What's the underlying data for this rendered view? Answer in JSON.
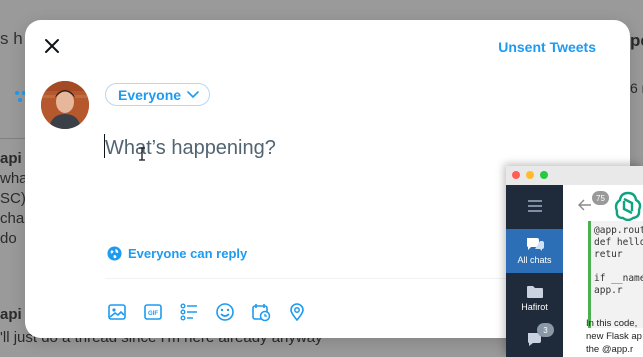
{
  "background": {
    "top_fragment": "s h",
    "right_top_fragment": "pe",
    "right_fragment": "6 m",
    "left_bold_fragment": "api",
    "left_lines": [
      "wha",
      "SC)",
      "cha",
      "do"
    ],
    "bottom_bold_fragment": "api",
    "bottom_text": "'ll just do a thread since I'm here already anyway"
  },
  "modal": {
    "unsent_label": "Unsent Tweets",
    "audience_label": "Everyone",
    "compose_placeholder": "What’s happening?",
    "reply_label": "Everyone can reply",
    "toolbar": [
      {
        "icon": "image-icon",
        "label": "Media"
      },
      {
        "icon": "gif-icon",
        "label": "GIF"
      },
      {
        "icon": "poll-icon",
        "label": "Poll"
      },
      {
        "icon": "emoji-icon",
        "label": "Emoji"
      },
      {
        "icon": "schedule-icon",
        "label": "Schedule"
      },
      {
        "icon": "location-icon",
        "label": "Location"
      }
    ]
  },
  "app": {
    "sidebar": [
      {
        "label": "All chats",
        "icon": "chat-bubbles-icon",
        "active": true
      },
      {
        "label": "Hafirot",
        "icon": "folder-icon",
        "active": false
      },
      {
        "label": "",
        "icon": "chat-icon",
        "badge": "3",
        "active": false
      }
    ],
    "header_badge": "75",
    "code_lines": [
      "@app.rout",
      "def hello",
      "    retur",
      "",
      "if __name_",
      "    app.r"
    ],
    "text_lines": [
      "In this code,",
      "new Flask ap",
      "the @app.r"
    ]
  },
  "colors": {
    "accent": "#1d9bf0",
    "app_sidebar": "#1f2a3a",
    "app_active": "#2d6fb6"
  }
}
